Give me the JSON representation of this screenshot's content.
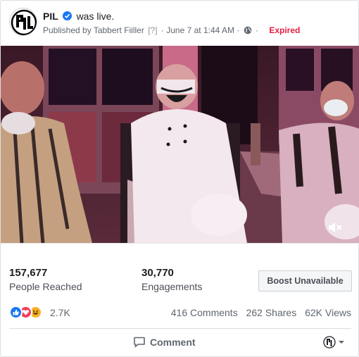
{
  "header": {
    "page_name": "PIL",
    "was_live": "was live.",
    "published_by": "Published by Tabbert Fiiller",
    "help_marker": "[?]",
    "date_sep": "·",
    "date": "June 7 at 1:44 AM",
    "dot": "·",
    "status": "Expired"
  },
  "video": {
    "mute_icon": "speaker-muted-icon"
  },
  "stats": {
    "people_reached_value": "157,677",
    "people_reached_label": "People Reached",
    "engagements_value": "30,770",
    "engagements_label": "Engagements",
    "boost_label": "Boost Unavailable"
  },
  "reactions": {
    "icons": [
      "like-icon",
      "love-icon",
      "haha-icon"
    ],
    "count": "2.7K",
    "comments": "416 Comments",
    "shares": "262 Shares",
    "views": "62K Views"
  },
  "actions": {
    "comment_label": "Comment"
  },
  "colors": {
    "link_blue": "#1877f2",
    "expired_red": "#e41e3f",
    "text_secondary": "#606770"
  }
}
